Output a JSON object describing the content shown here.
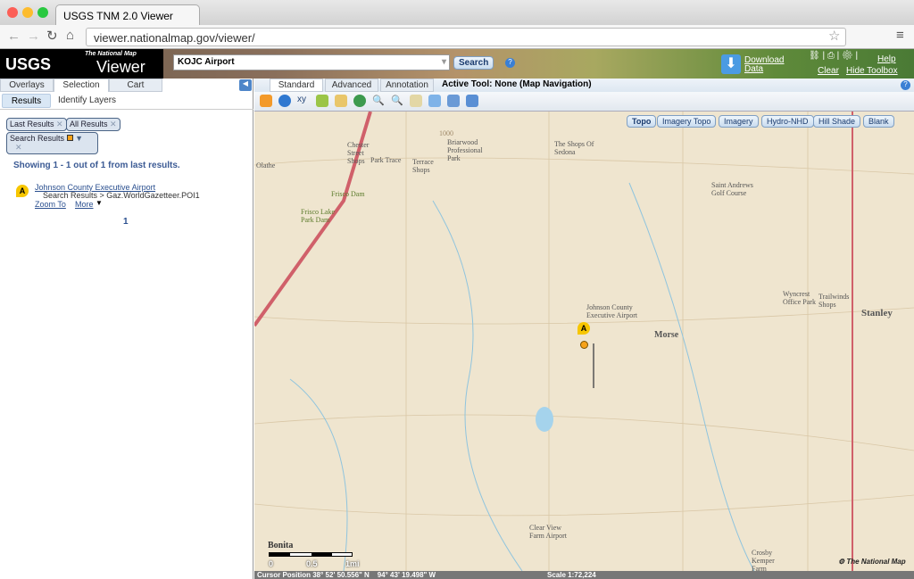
{
  "browser": {
    "tab_title": "USGS TNM 2.0 Viewer",
    "url": "viewer.nationalmap.gov/viewer/"
  },
  "header": {
    "logo_usgs": "USGS",
    "logo_small": "The National Map",
    "logo_viewer": "Viewer",
    "search_value": "KOJC Airport",
    "search_button": "Search",
    "download": [
      "Download",
      "Data"
    ],
    "links": {
      "help": "Help",
      "clear": "Clear",
      "hide_toolbox": "Hide Toolbox"
    }
  },
  "left": {
    "tabs": [
      "Overlays",
      "Selection",
      "Cart"
    ],
    "subtabs": [
      "Results",
      "Identify Layers"
    ],
    "chips": [
      "Last Results",
      "All Results",
      "Search Results"
    ],
    "showing": "Showing 1 - 1 out of 1 from last results.",
    "result": {
      "marker": "A",
      "title": "Johnson County Executive Airport",
      "path": "Search Results > Gaz.WorldGazetteer.POI1",
      "zoom": "Zoom To",
      "more": "More"
    },
    "page": "1"
  },
  "map": {
    "tabs": [
      "Standard",
      "Advanced",
      "Annotation"
    ],
    "active_tool": "Active Tool: None (Map Navigation)",
    "basemaps": [
      "Topo",
      "Imagery Topo",
      "Imagery",
      "Hydro-NHD",
      "Hill Shade",
      "Blank"
    ],
    "places": [
      "Chester Street Shops",
      "Park Trace",
      "Briarwood Professional Park",
      "The Shops Of Sedona",
      "Terrace Shops",
      "Frisco Dam",
      "Frisco Lake Park Dam",
      "Saint Andrews Golf Course",
      "Johnson County Executive Airport",
      "Morse",
      "Wyncrest Office Park",
      "Trailwinds Shops",
      "Stanley",
      "Clear View Farm Airport",
      "Crosby Kemper Farm",
      "Bonita",
      "1000",
      "Olathe"
    ],
    "scale_labels": [
      "0",
      "0.5",
      "1mi"
    ],
    "credit": "The National Map",
    "marker": "A"
  },
  "status": {
    "cursor": "Cursor Position 38° 52' 50.556\" N    94° 43' 19.498\" W",
    "scale": "Scale  1:72,224"
  }
}
